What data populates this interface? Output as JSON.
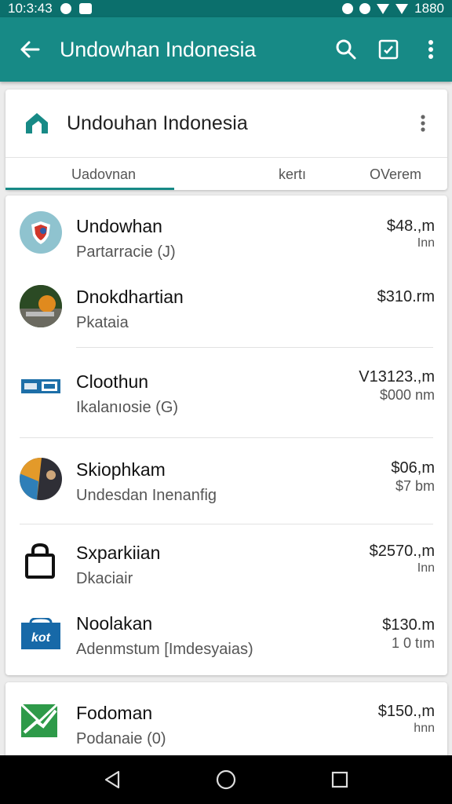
{
  "status_bar": {
    "time": "10:3:43",
    "battery": "1880"
  },
  "app_bar": {
    "title": "Undowhan Indonesia"
  },
  "header": {
    "name": "Undouhan Indonesia",
    "tabs": [
      {
        "label": "Uadovnan"
      },
      {
        "label": "kertı"
      },
      {
        "label": "OVerem"
      }
    ]
  },
  "items": [
    {
      "title": "Undowhan",
      "subtitle": "Partarracie (J)",
      "amount": "$48.,m",
      "amount_sub": "Inn"
    },
    {
      "title": "Dnokdhartian",
      "subtitle": "Pkataia",
      "amount": "$310.rm",
      "amount_sub": ""
    },
    {
      "title": "Cloothun",
      "subtitle": "Ikalanıosie (G)",
      "amount": "V13123.,m",
      "amount_sub": "$000 nm"
    },
    {
      "title": "Skiophkam",
      "subtitle": "Undesdan Inenanfig",
      "amount": "$06,m",
      "amount_sub": "$7 bm"
    },
    {
      "title": "Sxparkiian",
      "subtitle": "Dkaciair",
      "amount": "$2570.,m",
      "amount_sub": "Inn"
    },
    {
      "title": "Noolakan",
      "subtitle": "Adenmstum [Imdesyaias)",
      "amount": "$130.m",
      "amount_sub": "1 0 tım"
    },
    {
      "title": "Fodoman",
      "subtitle": "Podanaie (0)",
      "amount": "$150.,m",
      "amount_sub": "hnn"
    }
  ],
  "colors": {
    "primary": "#178a86",
    "status_bar": "#0b6f6c",
    "background": "#ececec"
  }
}
